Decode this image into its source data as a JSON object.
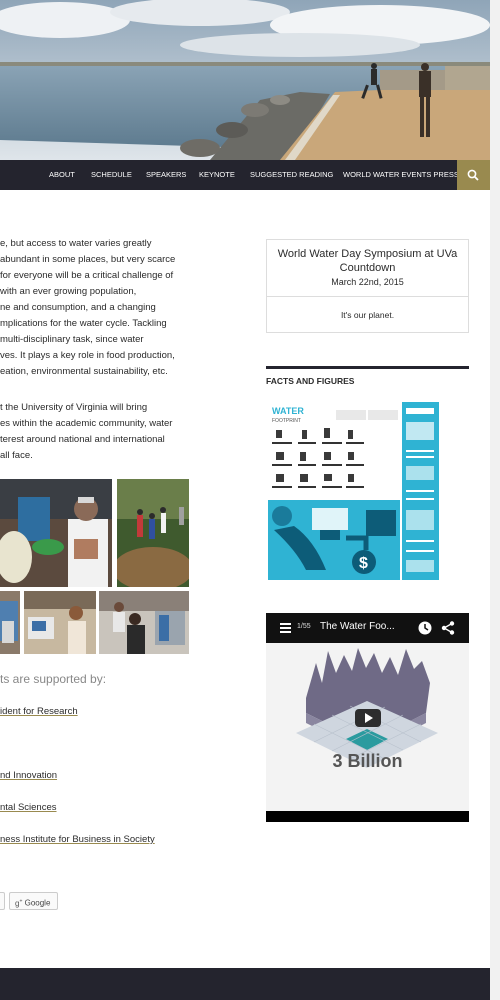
{
  "nav": {
    "items": [
      "About",
      "Schedule",
      "Speakers",
      "Keynote",
      "Suggested Reading",
      "World Water Events Press"
    ]
  },
  "main": {
    "paragraph1": [
      "e, but access to water varies greatly",
      "abundant in some places, but very scarce",
      "for everyone will be a critical challenge of",
      "with an ever growing population,",
      "ne and consumption, and a changing",
      "mplications for the water cycle. Tackling",
      "multi-disciplinary task, since water",
      "ves. It plays a key role in food production,",
      "eation, environmental sustainability, etc."
    ],
    "paragraph2": [
      "t the University of Virginia will bring",
      "es within the academic community, water",
      "terest around national and international",
      " all face."
    ],
    "supported_by": "ts are supported by:",
    "links": [
      "ident for Research",
      "nd Innovation",
      "ntal Sciences",
      "ness Institute for Business in Society"
    ],
    "google_button": "Google"
  },
  "sidebar": {
    "countdown": {
      "title": "World Water Day Symposium at UVa Countdown",
      "date": "March 22nd, 2015",
      "message": "It's our planet."
    },
    "facts_title": "Facts and Figures",
    "infographic": {
      "title_1": "WATER",
      "title_2": "FOOTPRINT"
    },
    "video": {
      "count": "1/55",
      "title": "The Water Foo...",
      "caption": "3 Billion"
    }
  },
  "colors": {
    "nav_bg": "#24242e",
    "accent": "#998a4f",
    "infographic_blue": "#2fb3d3"
  }
}
